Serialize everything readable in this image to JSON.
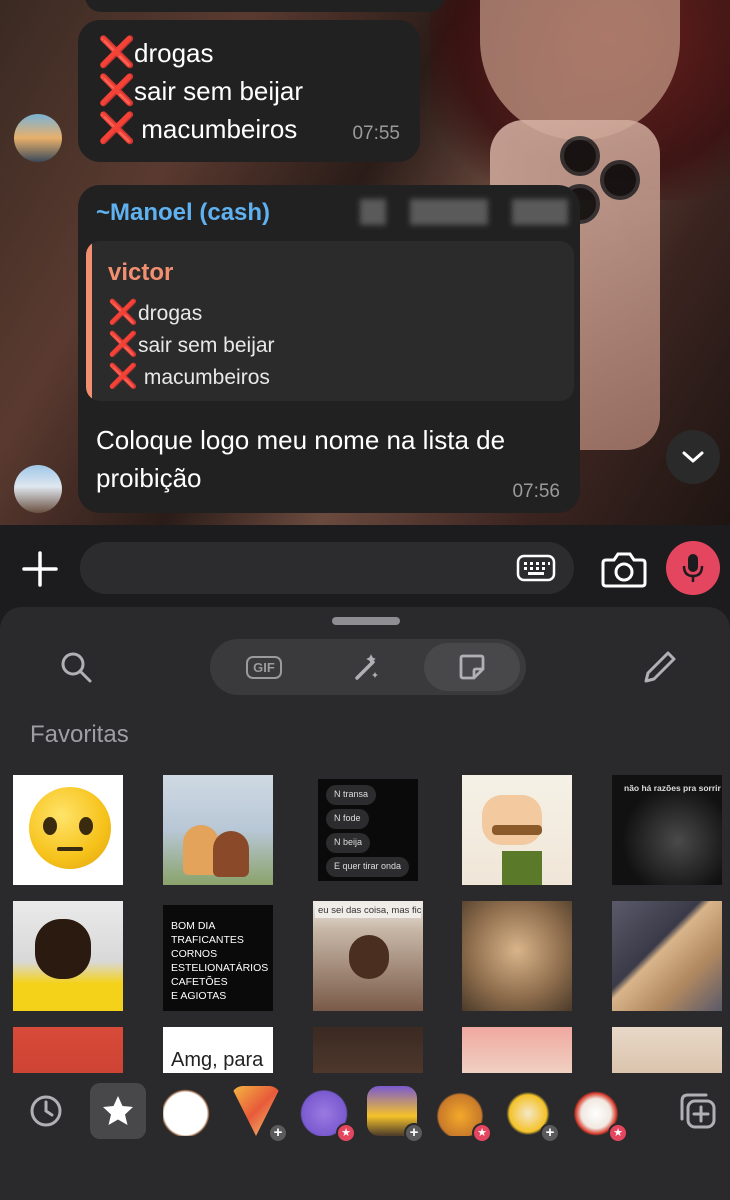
{
  "messages": [
    {
      "lines": [
        "drogas",
        "sair sem beijar",
        " macumbeiros"
      ],
      "time": "07:55"
    },
    {
      "sender": "~Manoel (cash)",
      "quote": {
        "name": "victor",
        "lines": [
          "drogas",
          "sair sem beijar",
          " macumbeiros"
        ]
      },
      "text": "Coloque logo meu nome na lista de proibição",
      "time": "07:56"
    }
  ],
  "icons": {
    "cross": "❌",
    "attach": "plus-icon",
    "keyboard": "keyboard-icon",
    "camera": "camera-icon",
    "mic": "microphone-icon",
    "scroll_down": "chevron-down-icon"
  },
  "colors": {
    "sender": "#5fb1f0",
    "quote_accent": "#f28f70",
    "mic_button": "#e5465f",
    "bubble": "#212121",
    "panel": "#2a2a2c"
  },
  "panel": {
    "tabs": [
      "search-icon",
      "gif-tab",
      "magic-pen-tab",
      "sticker-tab",
      "pencil-icon"
    ],
    "gif_label": "GIF",
    "section_title": "Favoritas",
    "stickers": {
      "chat_lines": [
        "N transa",
        "N fode",
        "N beija",
        "E quer tirar onda"
      ],
      "monkey_caption": "não há razões pra sorrir",
      "list_text": [
        "BOM DIA",
        "TRAFICANTES",
        "CORNOS",
        "ESTELIONATÁRIOS",
        "CAFETÕES",
        "E AGIOTAS"
      ],
      "meme_caption": "eu sei das coisa, mas fico...",
      "amg_text": "Amg,   para"
    },
    "bottom_tabs": [
      "recent-icon",
      "favorites-star-icon",
      "coffee-sticker-pack",
      "pizza-sticker-pack",
      "purple-sticker-pack",
      "party-sticker-pack",
      "duck-sticker-pack",
      "goat-sticker-pack",
      "rooster-sticker-pack",
      "add-pack-icon"
    ],
    "add_badge": "+",
    "star_badge": "★"
  }
}
